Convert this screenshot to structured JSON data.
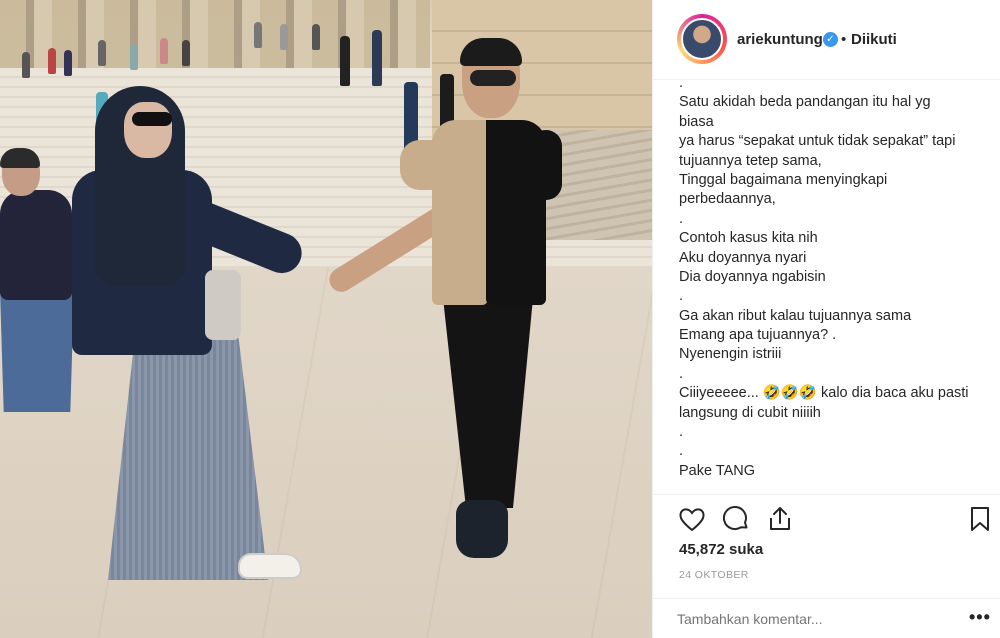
{
  "post": {
    "image_alt": "",
    "author": {
      "username": "ariekuntung",
      "verified_icon": "verified-badge-icon",
      "separator": "•",
      "follow_status": "Diikuti"
    },
    "caption_lines": [
      ".",
      "Satu akidah beda pandangan itu hal yg",
      "biasa",
      "ya harus “sepakat untuk tidak sepakat” tapi",
      "tujuannya tetep sama,",
      "Tinggal bagaimana menyingkapi",
      "perbedaannya,",
      ".",
      "Contoh kasus kita nih",
      "Aku doyannya nyari",
      "Dia doyannya ngabisin",
      ".",
      "Ga akan ribut kalau tujuannya sama",
      "Emang apa tujuannya? .",
      "Nyenengin istriii",
      ".",
      "Ciiiyeeeee... 🤣🤣🤣 kalo dia baca aku pasti",
      "langsung di cubit niiiih",
      ".",
      ".",
      "Pake TANG"
    ],
    "likes": "45,872 suka",
    "date": "24 OKTOBER",
    "comment_placeholder": "Tambahkan komentar...",
    "more_label": "•••",
    "icons": {
      "like": "heart-icon",
      "comment": "comment-icon",
      "share": "share-icon",
      "save": "bookmark-icon"
    },
    "colors": {
      "verified": "#3897f0",
      "text": "#262626",
      "muted": "#999999",
      "divider": "#efefef"
    }
  }
}
